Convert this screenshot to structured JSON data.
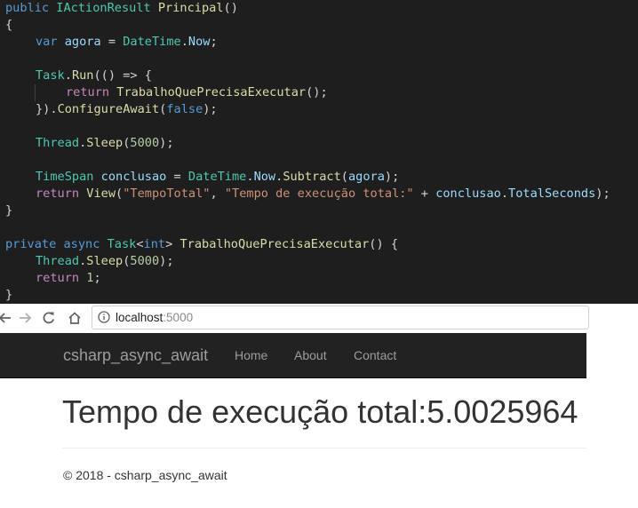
{
  "editor": {
    "lines": [
      [
        [
          "kw",
          "public "
        ],
        [
          "ty",
          "IActionResult "
        ],
        [
          "fn",
          "Principal"
        ],
        [
          "pl",
          "()"
        ]
      ],
      [
        [
          "pl",
          "{"
        ]
      ],
      [
        [
          "ind1",
          ""
        ],
        [
          "kw",
          "var "
        ],
        [
          "id",
          "agora "
        ],
        [
          "pl",
          "= "
        ],
        [
          "ty",
          "DateTime"
        ],
        [
          "pl",
          "."
        ],
        [
          "id",
          "Now"
        ],
        [
          "pl",
          ";"
        ]
      ],
      [
        [
          "pl",
          ""
        ]
      ],
      [
        [
          "ind1",
          ""
        ],
        [
          "ty",
          "Task"
        ],
        [
          "pl",
          "."
        ],
        [
          "fn",
          "Run"
        ],
        [
          "pl",
          "(() => {"
        ]
      ],
      [
        [
          "ind2",
          ""
        ],
        [
          "ctl",
          "return "
        ],
        [
          "fn",
          "TrabalhoQuePrecisaExecutar"
        ],
        [
          "pl",
          "();"
        ]
      ],
      [
        [
          "ind1",
          ""
        ],
        [
          "pl",
          "})."
        ],
        [
          "fn",
          "ConfigureAwait"
        ],
        [
          "pl",
          "("
        ],
        [
          "kw",
          "false"
        ],
        [
          "pl",
          ");"
        ]
      ],
      [
        [
          "pl",
          ""
        ]
      ],
      [
        [
          "ind1",
          ""
        ],
        [
          "ty",
          "Thread"
        ],
        [
          "pl",
          "."
        ],
        [
          "fn",
          "Sleep"
        ],
        [
          "pl",
          "("
        ],
        [
          "num",
          "5000"
        ],
        [
          "pl",
          ");"
        ]
      ],
      [
        [
          "pl",
          ""
        ]
      ],
      [
        [
          "ind1",
          ""
        ],
        [
          "ty",
          "TimeSpan "
        ],
        [
          "id",
          "conclusao "
        ],
        [
          "pl",
          "= "
        ],
        [
          "ty",
          "DateTime"
        ],
        [
          "pl",
          "."
        ],
        [
          "id",
          "Now"
        ],
        [
          "pl",
          "."
        ],
        [
          "fn",
          "Subtract"
        ],
        [
          "pl",
          "("
        ],
        [
          "id",
          "agora"
        ],
        [
          "pl",
          ");"
        ]
      ],
      [
        [
          "ind1",
          ""
        ],
        [
          "ctl",
          "return "
        ],
        [
          "fn",
          "View"
        ],
        [
          "pl",
          "("
        ],
        [
          "str",
          "\"TempoTotal\""
        ],
        [
          "pl",
          ", "
        ],
        [
          "str",
          "\"Tempo de execução total:\""
        ],
        [
          "pl",
          " + "
        ],
        [
          "id",
          "conclusao"
        ],
        [
          "pl",
          "."
        ],
        [
          "id",
          "TotalSeconds"
        ],
        [
          "pl",
          ");"
        ]
      ],
      [
        [
          "pl",
          "}"
        ]
      ],
      [
        [
          "pl",
          ""
        ]
      ],
      [
        [
          "kw",
          "private "
        ],
        [
          "kw",
          "async "
        ],
        [
          "ty",
          "Task"
        ],
        [
          "pl",
          "<"
        ],
        [
          "kw",
          "int"
        ],
        [
          "pl",
          "> "
        ],
        [
          "fn",
          "TrabalhoQuePrecisaExecutar"
        ],
        [
          "pl",
          "() {"
        ]
      ],
      [
        [
          "ind1",
          ""
        ],
        [
          "ty",
          "Thread"
        ],
        [
          "pl",
          "."
        ],
        [
          "fn",
          "Sleep"
        ],
        [
          "pl",
          "("
        ],
        [
          "num",
          "5000"
        ],
        [
          "pl",
          ");"
        ]
      ],
      [
        [
          "ind1",
          ""
        ],
        [
          "ctl",
          "return "
        ],
        [
          "num",
          "1"
        ],
        [
          "pl",
          ";"
        ]
      ],
      [
        [
          "pl",
          "}"
        ]
      ]
    ],
    "guide_lines": [
      5
    ]
  },
  "browser": {
    "back_icon": "arrow-left-icon",
    "forward_icon": "arrow-right-icon",
    "reload_icon": "reload-icon",
    "home_icon": "home-icon",
    "info_icon": "info-icon",
    "url_host": "localhost",
    "url_port": ":5000"
  },
  "site": {
    "brand": "csharp_async_await",
    "nav": [
      "Home",
      "About",
      "Contact"
    ],
    "heading": "Tempo de execução total:5.0025964",
    "footer": "© 2018 - csharp_async_await"
  },
  "colors": {
    "editor_bg": "#1e1e1e",
    "navbar_bg": "#222222",
    "nav_text": "#9d9d9d"
  }
}
